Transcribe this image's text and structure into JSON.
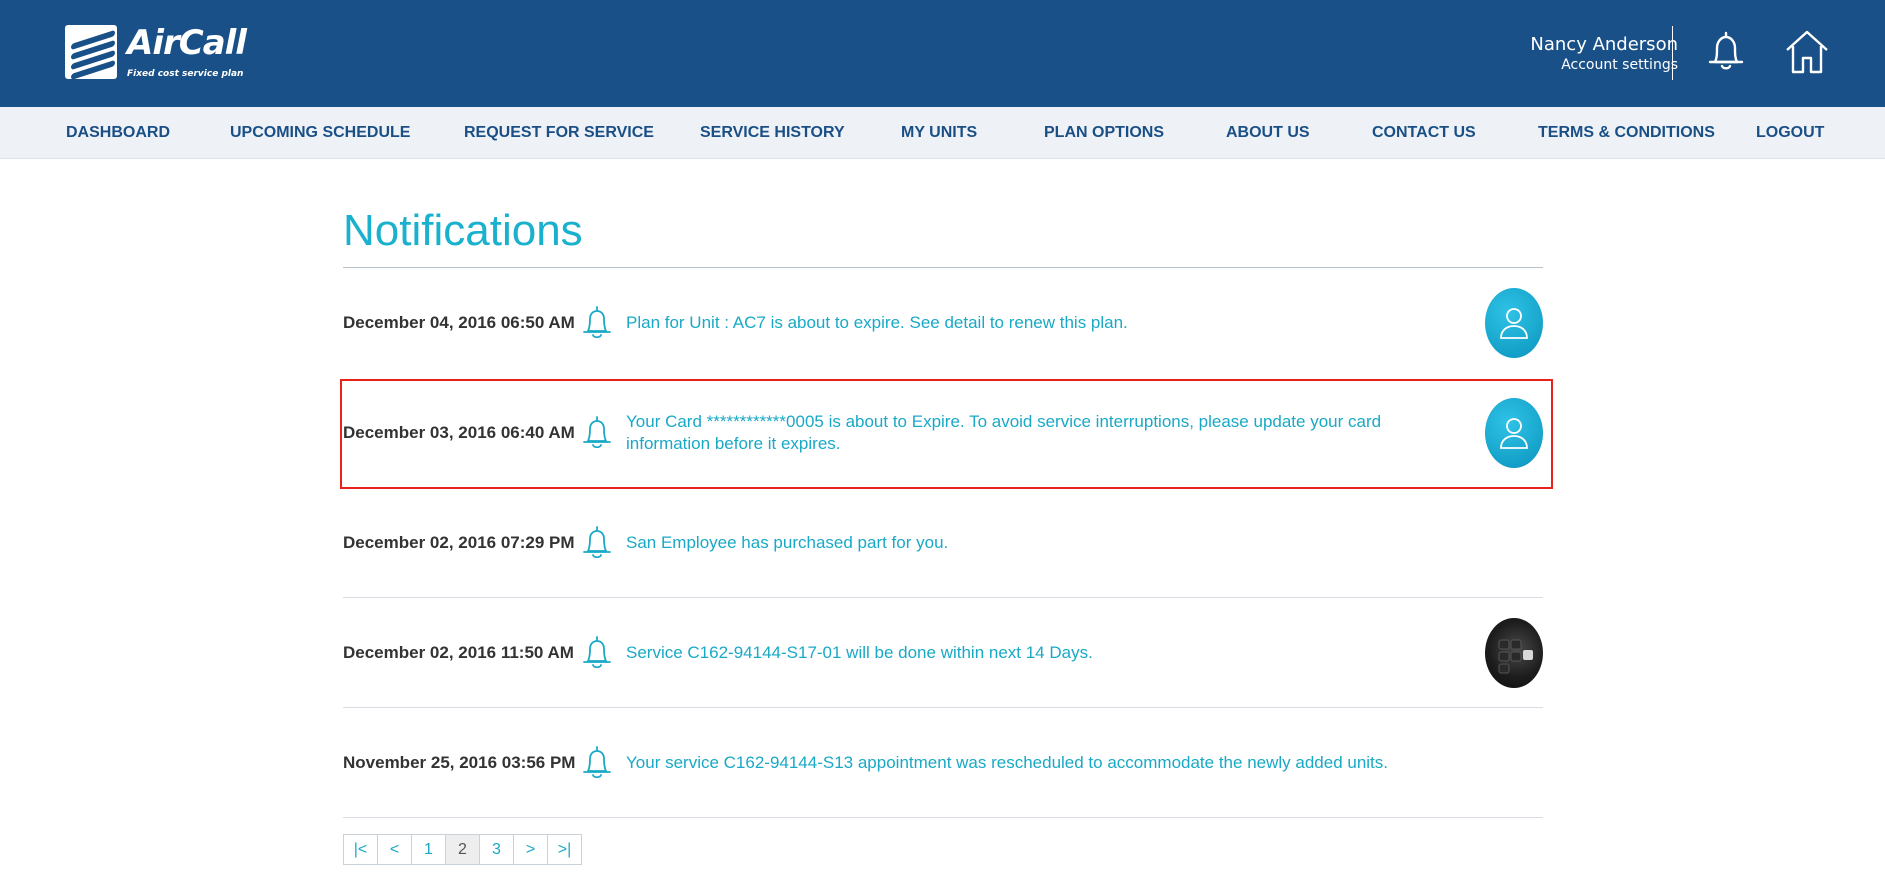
{
  "brand": {
    "name": "AirCall",
    "tagline": "Fixed cost service plan"
  },
  "user": {
    "name": "Nancy Anderson",
    "account_link": "Account settings"
  },
  "header_icons": [
    "bell-icon",
    "home-icon"
  ],
  "nav": {
    "items": [
      {
        "label": "DASHBOARD"
      },
      {
        "label": "UPCOMING SCHEDULE"
      },
      {
        "label": "REQUEST FOR SERVICE"
      },
      {
        "label": "SERVICE HISTORY"
      },
      {
        "label": "MY UNITS"
      },
      {
        "label": "PLAN OPTIONS"
      },
      {
        "label": "ABOUT US"
      },
      {
        "label": "CONTACT US"
      },
      {
        "label": "TERMS & CONDITIONS"
      },
      {
        "label": "LOGOUT"
      }
    ]
  },
  "page": {
    "title": "Notifications"
  },
  "notifications": [
    {
      "date": "December 04, 2016 06:50 AM",
      "message": "Plan for Unit : AC7 is about to expire. See detail to renew this plan.",
      "avatar": "user-avatar"
    },
    {
      "date": "December 03, 2016 06:40 AM",
      "message": "Your Card ************0005 is about to Expire. To avoid service interruptions, please update your card information before it expires.",
      "avatar": "user-avatar"
    },
    {
      "date": "December 02, 2016 07:29 PM",
      "message": "San Employee has purchased part for you.",
      "avatar": "none"
    },
    {
      "date": "December 02, 2016 11:50 AM",
      "message": "Service C162-94144-S17-01 will be done within next 14 Days.",
      "avatar": "photo-avatar"
    },
    {
      "date": "November 25, 2016 03:56 PM",
      "message": "Your service C162-94144-S13 appointment was rescheduled to accommodate the newly added units.",
      "avatar": "none"
    }
  ],
  "pagination": {
    "first": "|<",
    "prev": "<",
    "pages": [
      "1",
      "2",
      "3"
    ],
    "current": "2",
    "next": ">",
    "last": ">|"
  },
  "colors": {
    "header_bg": "#1a5088",
    "nav_bg": "#eef2f7",
    "nav_text": "#1a4f86",
    "accent": "#19b1cd",
    "highlight": "#e8231c"
  }
}
